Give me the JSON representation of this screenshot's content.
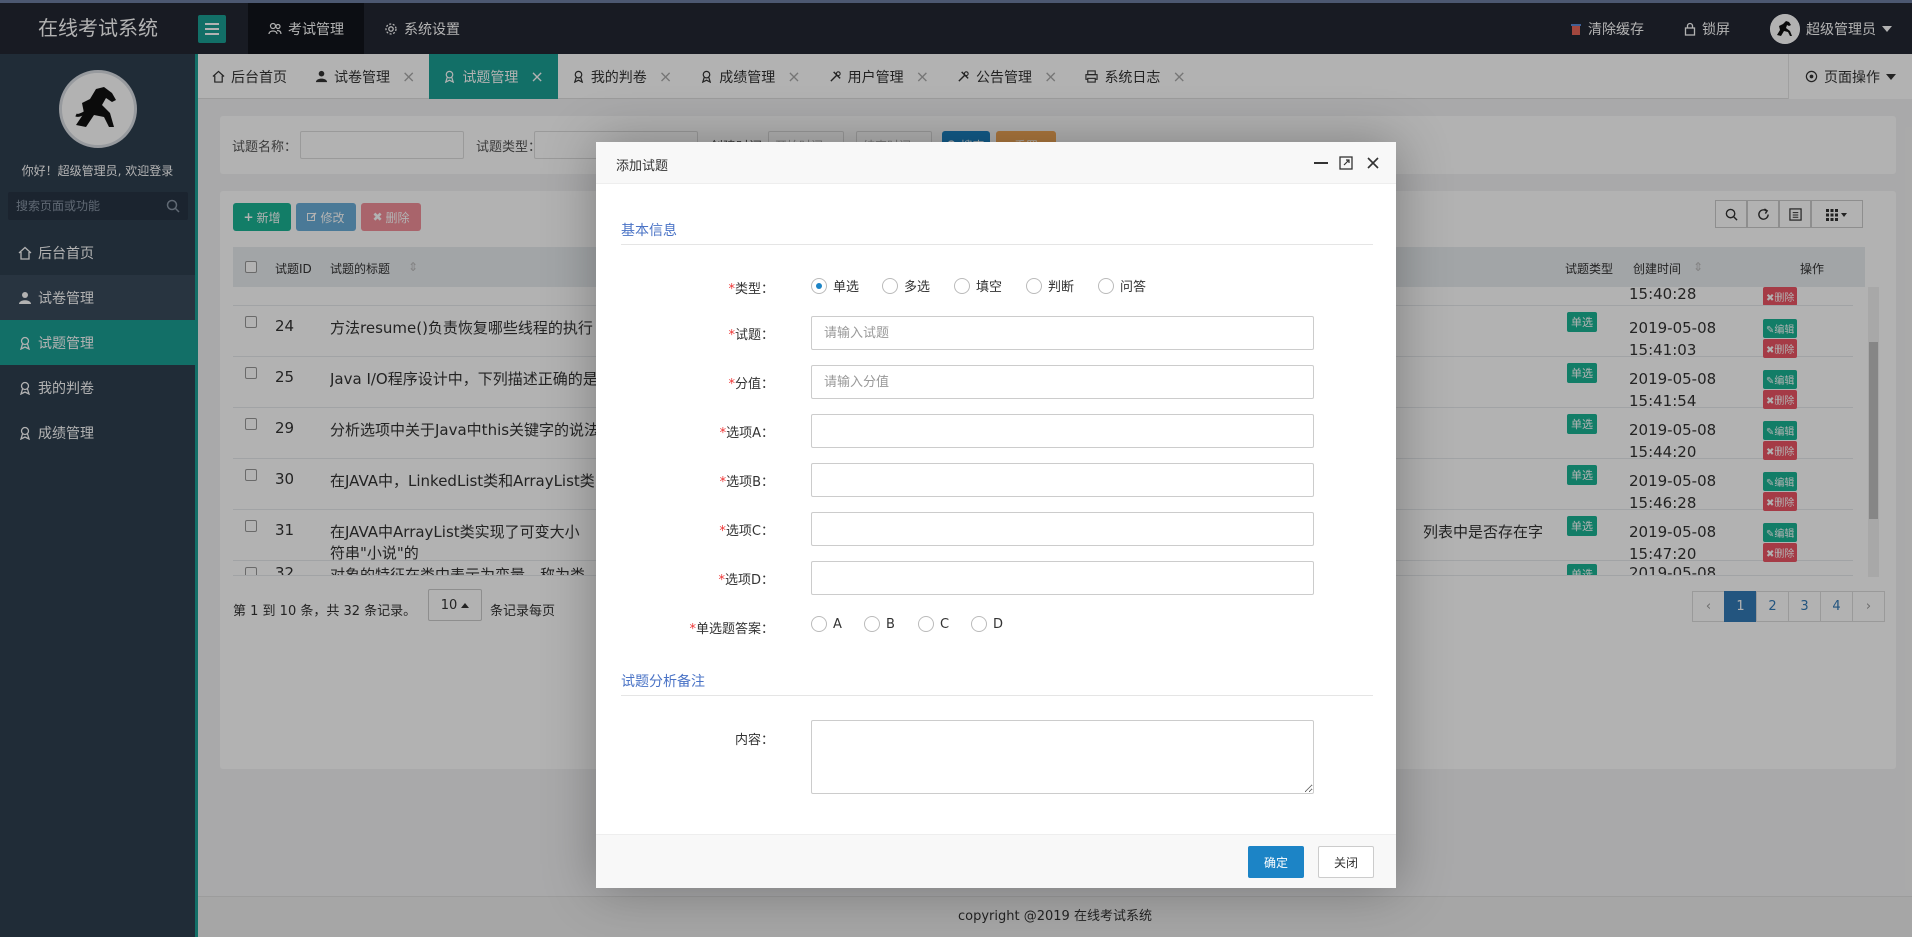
{
  "app": {
    "logo_text": "在线考试系统"
  },
  "topnav": [
    {
      "label": "考试管理",
      "icon": "users-icon",
      "active": true
    },
    {
      "label": "系统设置",
      "icon": "gear-icon",
      "active": false
    }
  ],
  "topright": {
    "clear_cache": "清除缓存",
    "lock": "锁屏",
    "user": "超级管理员"
  },
  "sidebar": {
    "welcome": "你好！超级管理员, 欢迎登录",
    "search_placeholder": "搜索页面或功能",
    "items": [
      {
        "label": "后台首页",
        "icon": "home-icon"
      },
      {
        "label": "试卷管理",
        "icon": "user-icon"
      },
      {
        "label": "试题管理",
        "icon": "badge-icon"
      },
      {
        "label": "我的判卷",
        "icon": "badge-icon"
      },
      {
        "label": "成绩管理",
        "icon": "badge-icon"
      }
    ]
  },
  "tabs": [
    {
      "label": "后台首页",
      "closable": false
    },
    {
      "label": "试卷管理",
      "closable": true
    },
    {
      "label": "试题管理",
      "closable": true,
      "active": true
    },
    {
      "label": "我的判卷",
      "closable": true
    },
    {
      "label": "成绩管理",
      "closable": true
    },
    {
      "label": "用户管理",
      "closable": true
    },
    {
      "label": "公告管理",
      "closable": true
    },
    {
      "label": "系统日志",
      "closable": true
    }
  ],
  "page_ops": "页面操作",
  "search_form": {
    "title_label": "试题名称：",
    "type_label": "试题类型：",
    "created_label": "创建时间：",
    "start_placeholder": "开始时间",
    "end_placeholder": "结束时间",
    "search_btn": "搜索",
    "reset_btn": "重置"
  },
  "toolbar": {
    "add": "新增",
    "edit": "修改",
    "delete": "删除"
  },
  "table": {
    "headers": {
      "id": "试题ID",
      "title": "试题的标题",
      "type": "试题类型",
      "created": "创建时间",
      "ops": "操作"
    },
    "partial_top": {
      "time": "15:40:28",
      "delete": "删除"
    },
    "rows": [
      {
        "id": "24",
        "title": "方法resume()负责恢复哪些线程的执行",
        "type": "单选",
        "date": "2019-05-08",
        "time": "15:41:03"
      },
      {
        "id": "25",
        "title": "Java I/O程序设计中，下列描述正确的是",
        "type": "单选",
        "date": "2019-05-08",
        "time": "15:41:54"
      },
      {
        "id": "29",
        "title": "分析选项中关于Java中this关键字的说法",
        "type": "单选",
        "date": "2019-05-08",
        "time": "15:44:20"
      },
      {
        "id": "30",
        "title": "在JAVA中，LinkedList类和ArrayList类",
        "type": "单选",
        "date": "2019-05-08",
        "time": "15:46:28"
      },
      {
        "id": "31",
        "title": "在JAVA中ArrayList类实现了可变大小",
        "title_end": "列表中是否存在字",
        "title_line2": "符串\"小说\"的",
        "type": "单选",
        "date": "2019-05-08",
        "time": "15:47:20"
      }
    ],
    "partial_bottom": {
      "id": "32",
      "title": "对象的特征在类中表示为变量，称为类",
      "type": "单选",
      "date": "2019-05-08"
    },
    "edit_label": "编辑",
    "delete_label": "删除"
  },
  "pagination": {
    "summary_prefix": "第 1 到 10 条，共 32 条记录。",
    "page_size": "10",
    "summary_suffix": "条记录每页",
    "prev": "‹",
    "next": "›",
    "pages": [
      "1",
      "2",
      "3",
      "4"
    ],
    "current": "1"
  },
  "footer": "copyright @2019 在线考试系统",
  "modal": {
    "title": "添加试题",
    "section_basic": "基本信息",
    "section_analysis": "试题分析备注",
    "type_label": "类型：",
    "type_options": [
      "单选",
      "多选",
      "填空",
      "判断",
      "问答"
    ],
    "type_selected": "单选",
    "question_label": "试题：",
    "question_placeholder": "请输入试题",
    "score_label": "分值：",
    "score_placeholder": "请输入分值",
    "optA_label": "选项A：",
    "optB_label": "选项B：",
    "optC_label": "选项C：",
    "optD_label": "选项D：",
    "answer_label": "单选题答案：",
    "answer_options": [
      "A",
      "B",
      "C",
      "D"
    ],
    "content_label": "内容：",
    "required_mark": "*",
    "confirm": "确定",
    "close": "关闭"
  },
  "colors": {
    "accent": "#1aa094",
    "primary": "#1c84c6",
    "sidebar": "#2f4050",
    "topbar": "#232733"
  }
}
